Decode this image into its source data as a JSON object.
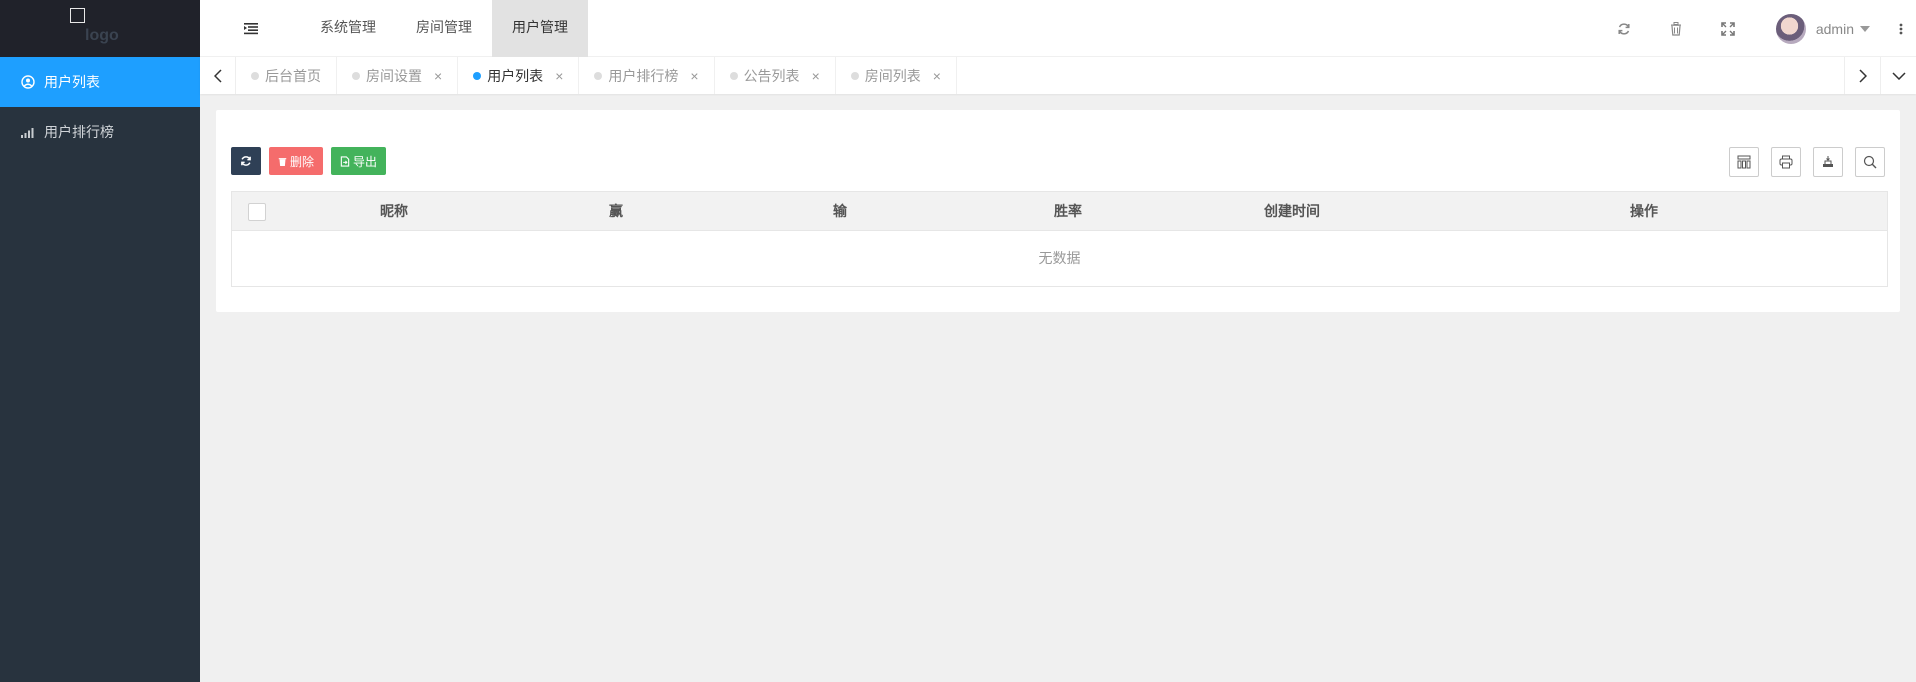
{
  "logo": {
    "text": "logo"
  },
  "sidebar": {
    "items": [
      {
        "label": "用户列表",
        "icon": "user-circle-icon",
        "active": true
      },
      {
        "label": "用户排行榜",
        "icon": "signal-bars-icon",
        "active": false
      }
    ]
  },
  "header": {
    "menu": [
      {
        "label": "系统管理"
      },
      {
        "label": "房间管理"
      },
      {
        "label": "用户管理",
        "active": true
      }
    ],
    "user": {
      "name": "admin"
    },
    "icons": [
      "refresh-icon",
      "trash-icon",
      "fullscreen-icon",
      "more-vertical-icon"
    ]
  },
  "tabs": [
    {
      "label": "后台首页",
      "closable": false
    },
    {
      "label": "房间设置",
      "closable": true
    },
    {
      "label": "用户列表",
      "closable": true,
      "active": true
    },
    {
      "label": "用户排行榜",
      "closable": true
    },
    {
      "label": "公告列表",
      "closable": true
    },
    {
      "label": "房间列表",
      "closable": true
    }
  ],
  "toolbar": {
    "delete_label": "删除",
    "export_label": "导出"
  },
  "table": {
    "columns": [
      "昵称",
      "赢",
      "输",
      "胜率",
      "创建时间",
      "操作"
    ],
    "empty_text": "无数据"
  },
  "colors": {
    "sidebar_bg": "#28333e",
    "active_blue": "#1e9fff",
    "delete_red": "#f56c6c",
    "export_green": "#43b35b",
    "refresh_dark": "#2f4056"
  }
}
